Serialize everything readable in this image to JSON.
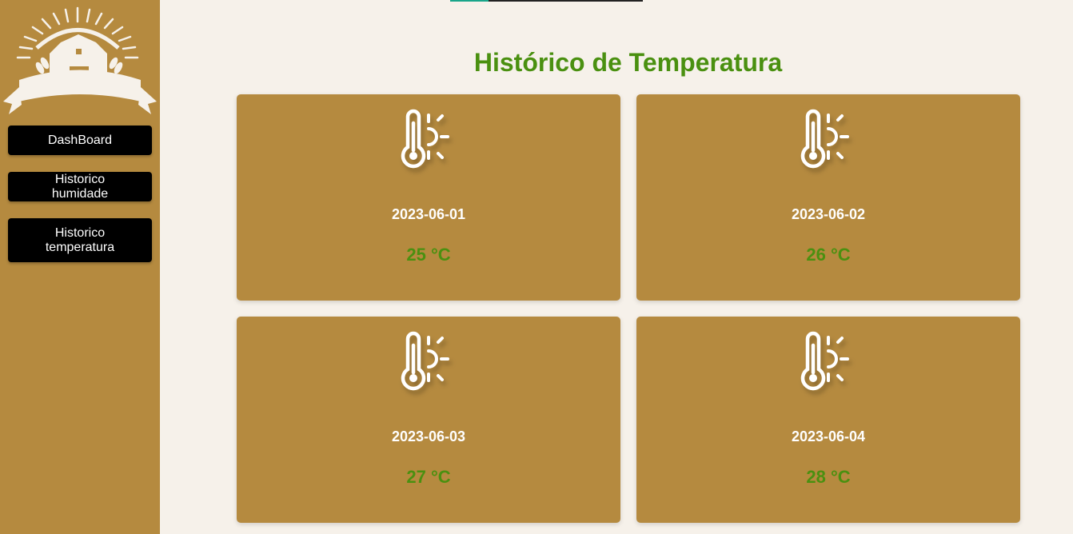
{
  "sidebar": {
    "logo_icon": "farm-barn-logo",
    "items": [
      {
        "label": "DashBoard"
      },
      {
        "label": "Historico humidade"
      },
      {
        "label": "Historico temperatura"
      }
    ]
  },
  "page": {
    "title": "Histórico de Temperatura"
  },
  "cards": [
    {
      "date": "2023-06-01",
      "temperature": "25 °C",
      "icon": "thermometer-sun-icon"
    },
    {
      "date": "2023-06-02",
      "temperature": "26 °C",
      "icon": "thermometer-sun-icon"
    },
    {
      "date": "2023-06-03",
      "temperature": "27 °C",
      "icon": "thermometer-sun-icon"
    },
    {
      "date": "2023-06-04",
      "temperature": "28 °C",
      "icon": "thermometer-sun-icon"
    }
  ],
  "colors": {
    "sidebar": "#b58a3f",
    "background": "#f6f1ea",
    "accent_green": "#4a9010",
    "button": "#000000"
  }
}
